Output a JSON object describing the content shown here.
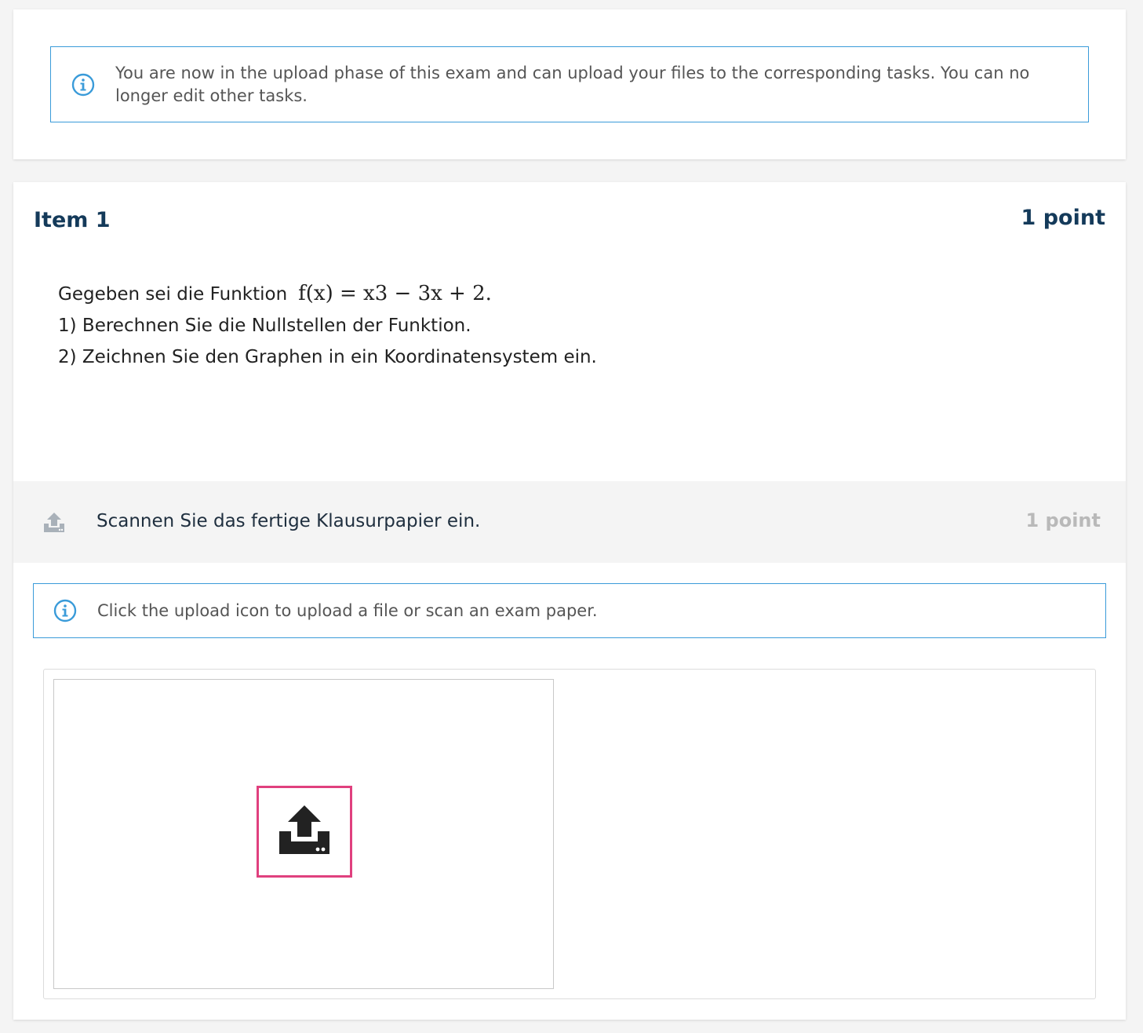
{
  "banner": {
    "message": "You are now in the upload phase of this exam and can upload your files to the corresponding tasks. You can no longer edit other tasks.",
    "icon": "info-icon"
  },
  "item": {
    "title": "Item 1",
    "points": "1 point",
    "question": {
      "intro": "Gegeben sei die Funktion",
      "formula": "f(x) = x3 − 3x + 2.",
      "line1": "1) Berechnen Sie die Nullstellen der Funktion.",
      "line2": "2) Zeichnen Sie den Graphen in ein Koordinatensystem ein."
    },
    "upload_task": {
      "icon": "upload-icon",
      "label": "Scannen Sie das fertige Klausurpapier ein.",
      "points": "1 point"
    },
    "upload_hint": {
      "icon": "info-icon",
      "message": "Click the upload icon to upload a file or scan an exam paper."
    },
    "upload_button_icon": "upload-icon"
  },
  "colors": {
    "accent": "#3a9bd9",
    "title": "#143a5a",
    "highlight": "#e0407e",
    "muted_points": "#b9b9b9"
  }
}
